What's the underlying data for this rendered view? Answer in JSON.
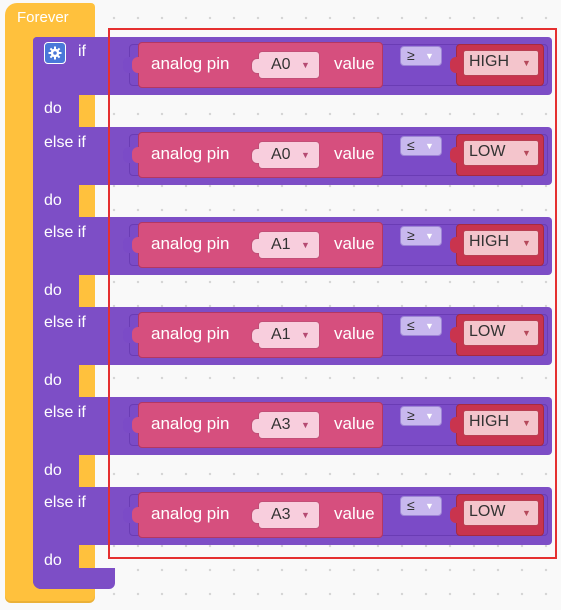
{
  "forever_label": "Forever",
  "keywords": {
    "if": "if",
    "do": "do",
    "else_if": "else if"
  },
  "settings_icon": "gear-icon",
  "rows": [
    {
      "analog_label": "analog pin",
      "pin": "A0",
      "value_label": "value",
      "operator": "≥",
      "level": "HIGH"
    },
    {
      "analog_label": "analog pin",
      "pin": "A0",
      "value_label": "value",
      "operator": "≤",
      "level": "LOW"
    },
    {
      "analog_label": "analog pin",
      "pin": "A1",
      "value_label": "value",
      "operator": "≥",
      "level": "HIGH"
    },
    {
      "analog_label": "analog pin",
      "pin": "A1",
      "value_label": "value",
      "operator": "≤",
      "level": "LOW"
    },
    {
      "analog_label": "analog pin",
      "pin": "A3",
      "value_label": "value",
      "operator": "≥",
      "level": "HIGH"
    },
    {
      "analog_label": "analog pin",
      "pin": "A3",
      "value_label": "value",
      "operator": "≤",
      "level": "LOW"
    }
  ],
  "colors": {
    "forever": "#ffc13d",
    "control": "#7d4ec6",
    "analog_block": "#d64f7e",
    "level_block": "#c9344e",
    "highlight": "#e53030"
  }
}
